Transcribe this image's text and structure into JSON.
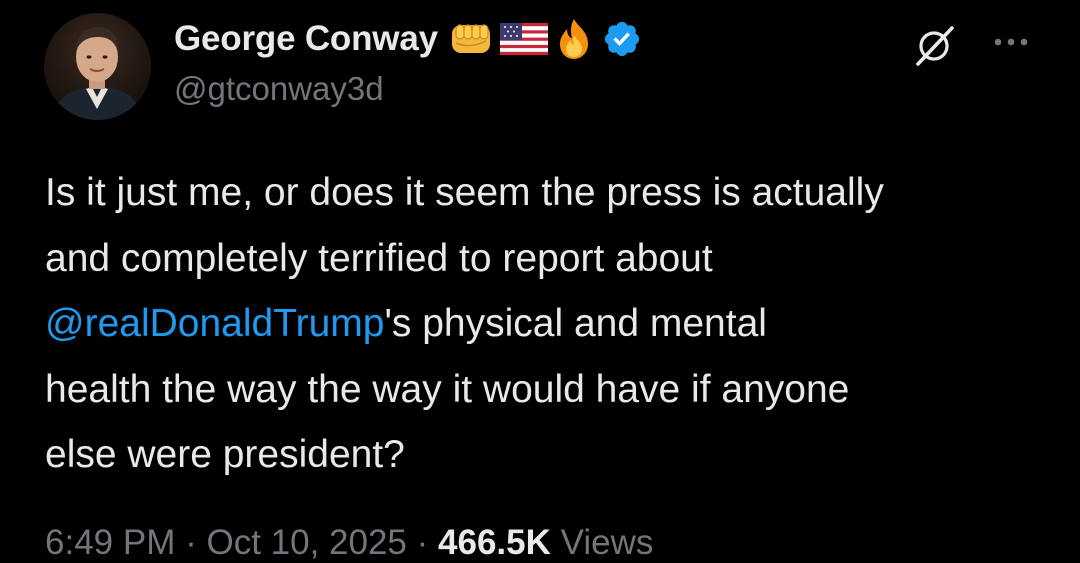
{
  "author": {
    "display_name": "George Conway",
    "handle": "@gtconway3d",
    "emojis": [
      "fist-emoji",
      "us-flag-emoji",
      "fire-emoji"
    ],
    "verified_badge": "verified-badge-icon",
    "verified_color": "#1d9bf0"
  },
  "header_actions": {
    "grok_icon": "grok-icon",
    "more_icon": "more-options-icon"
  },
  "tweet": {
    "line1": "Is it just me, or does it seem the press is actually",
    "line2": "and completely terrified to report about",
    "mention": "@realDonaldTrump",
    "line3_rest": "'s physical and mental",
    "line4": "health the way the way it would have if anyone",
    "line5": "else were president?"
  },
  "meta": {
    "time": "6:49 PM",
    "separator": "·",
    "date": "Oct 10, 2025",
    "views_count": "466.5K",
    "views_label": "Views"
  },
  "colors": {
    "background": "#000000",
    "text": "#e7e9ea",
    "secondary_text": "#71767b",
    "link": "#1d9bf0"
  }
}
